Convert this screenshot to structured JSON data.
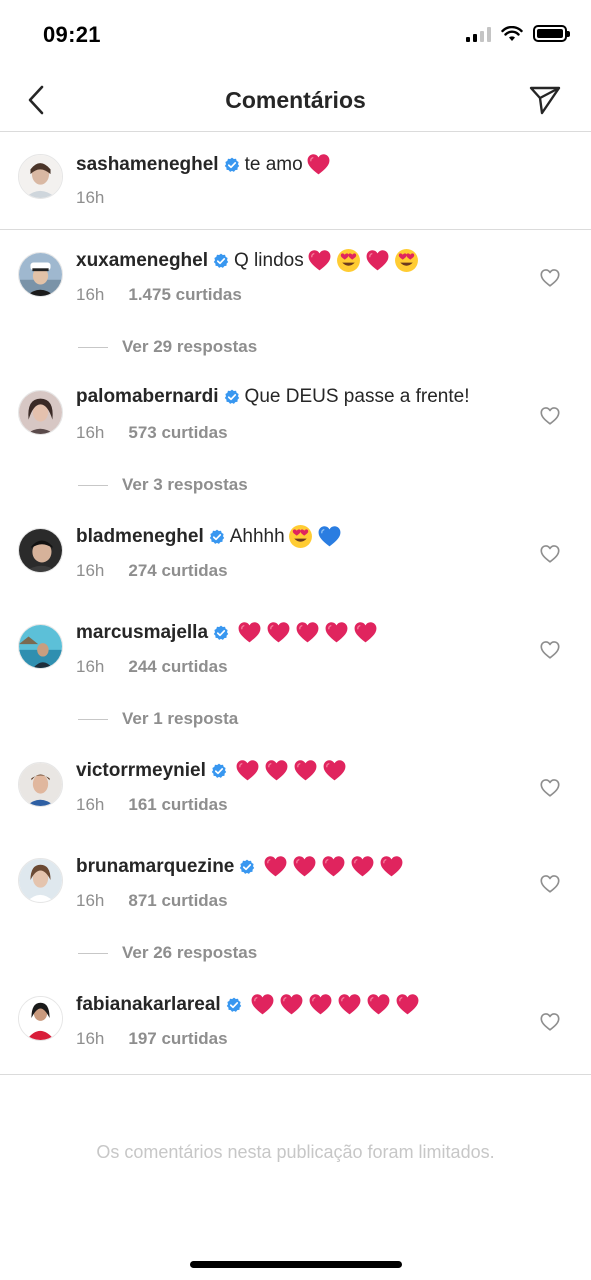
{
  "status_bar": {
    "time": "09:21"
  },
  "header": {
    "title": "Comentários"
  },
  "caption": {
    "username": "sashameneghel",
    "text": "te amo",
    "emojis": [
      "red-heart"
    ],
    "time": "16h"
  },
  "comments": [
    {
      "username": "xuxameneghel",
      "text": "Q lindos",
      "emojis": [
        "red-heart",
        "heart-eyes",
        "red-heart",
        "heart-eyes"
      ],
      "time": "16h",
      "likes": "1.475 curtidas",
      "replies": "Ver 29 respostas"
    },
    {
      "username": "palomabernardi",
      "text": "Que DEUS passe a frente!",
      "emojis": [],
      "time": "16h",
      "likes": "573 curtidas",
      "replies": "Ver 3 respostas"
    },
    {
      "username": "bladmeneghel",
      "text": "Ahhhh",
      "emojis": [
        "heart-eyes",
        "blue-heart"
      ],
      "time": "16h",
      "likes": "274 curtidas",
      "replies": ""
    },
    {
      "username": "marcusmajella",
      "text": "",
      "emojis": [
        "red-heart",
        "red-heart",
        "red-heart",
        "red-heart",
        "red-heart"
      ],
      "time": "16h",
      "likes": "244 curtidas",
      "replies": "Ver 1 resposta"
    },
    {
      "username": "victorrmeyniel",
      "text": "",
      "emojis": [
        "red-heart",
        "red-heart",
        "red-heart",
        "red-heart"
      ],
      "time": "16h",
      "likes": "161 curtidas",
      "replies": ""
    },
    {
      "username": "brunamarquezine",
      "text": "",
      "emojis": [
        "red-heart",
        "red-heart",
        "red-heart",
        "red-heart",
        "red-heart"
      ],
      "time": "16h",
      "likes": "871 curtidas",
      "replies": "Ver 26 respostas"
    },
    {
      "username": "fabianakarlareal",
      "text": "",
      "emojis": [
        "red-heart",
        "red-heart",
        "red-heart",
        "red-heart",
        "red-heart",
        "red-heart"
      ],
      "time": "16h",
      "likes": "197 curtidas",
      "replies": ""
    }
  ],
  "footer": {
    "limited_note": "Os comentários nesta publicação foram limitados."
  },
  "colors": {
    "verified": "#3897f0",
    "heart_red": "#e0245e",
    "heart_blue": "#2a7de1",
    "secondary_text": "#8e8e8e"
  }
}
